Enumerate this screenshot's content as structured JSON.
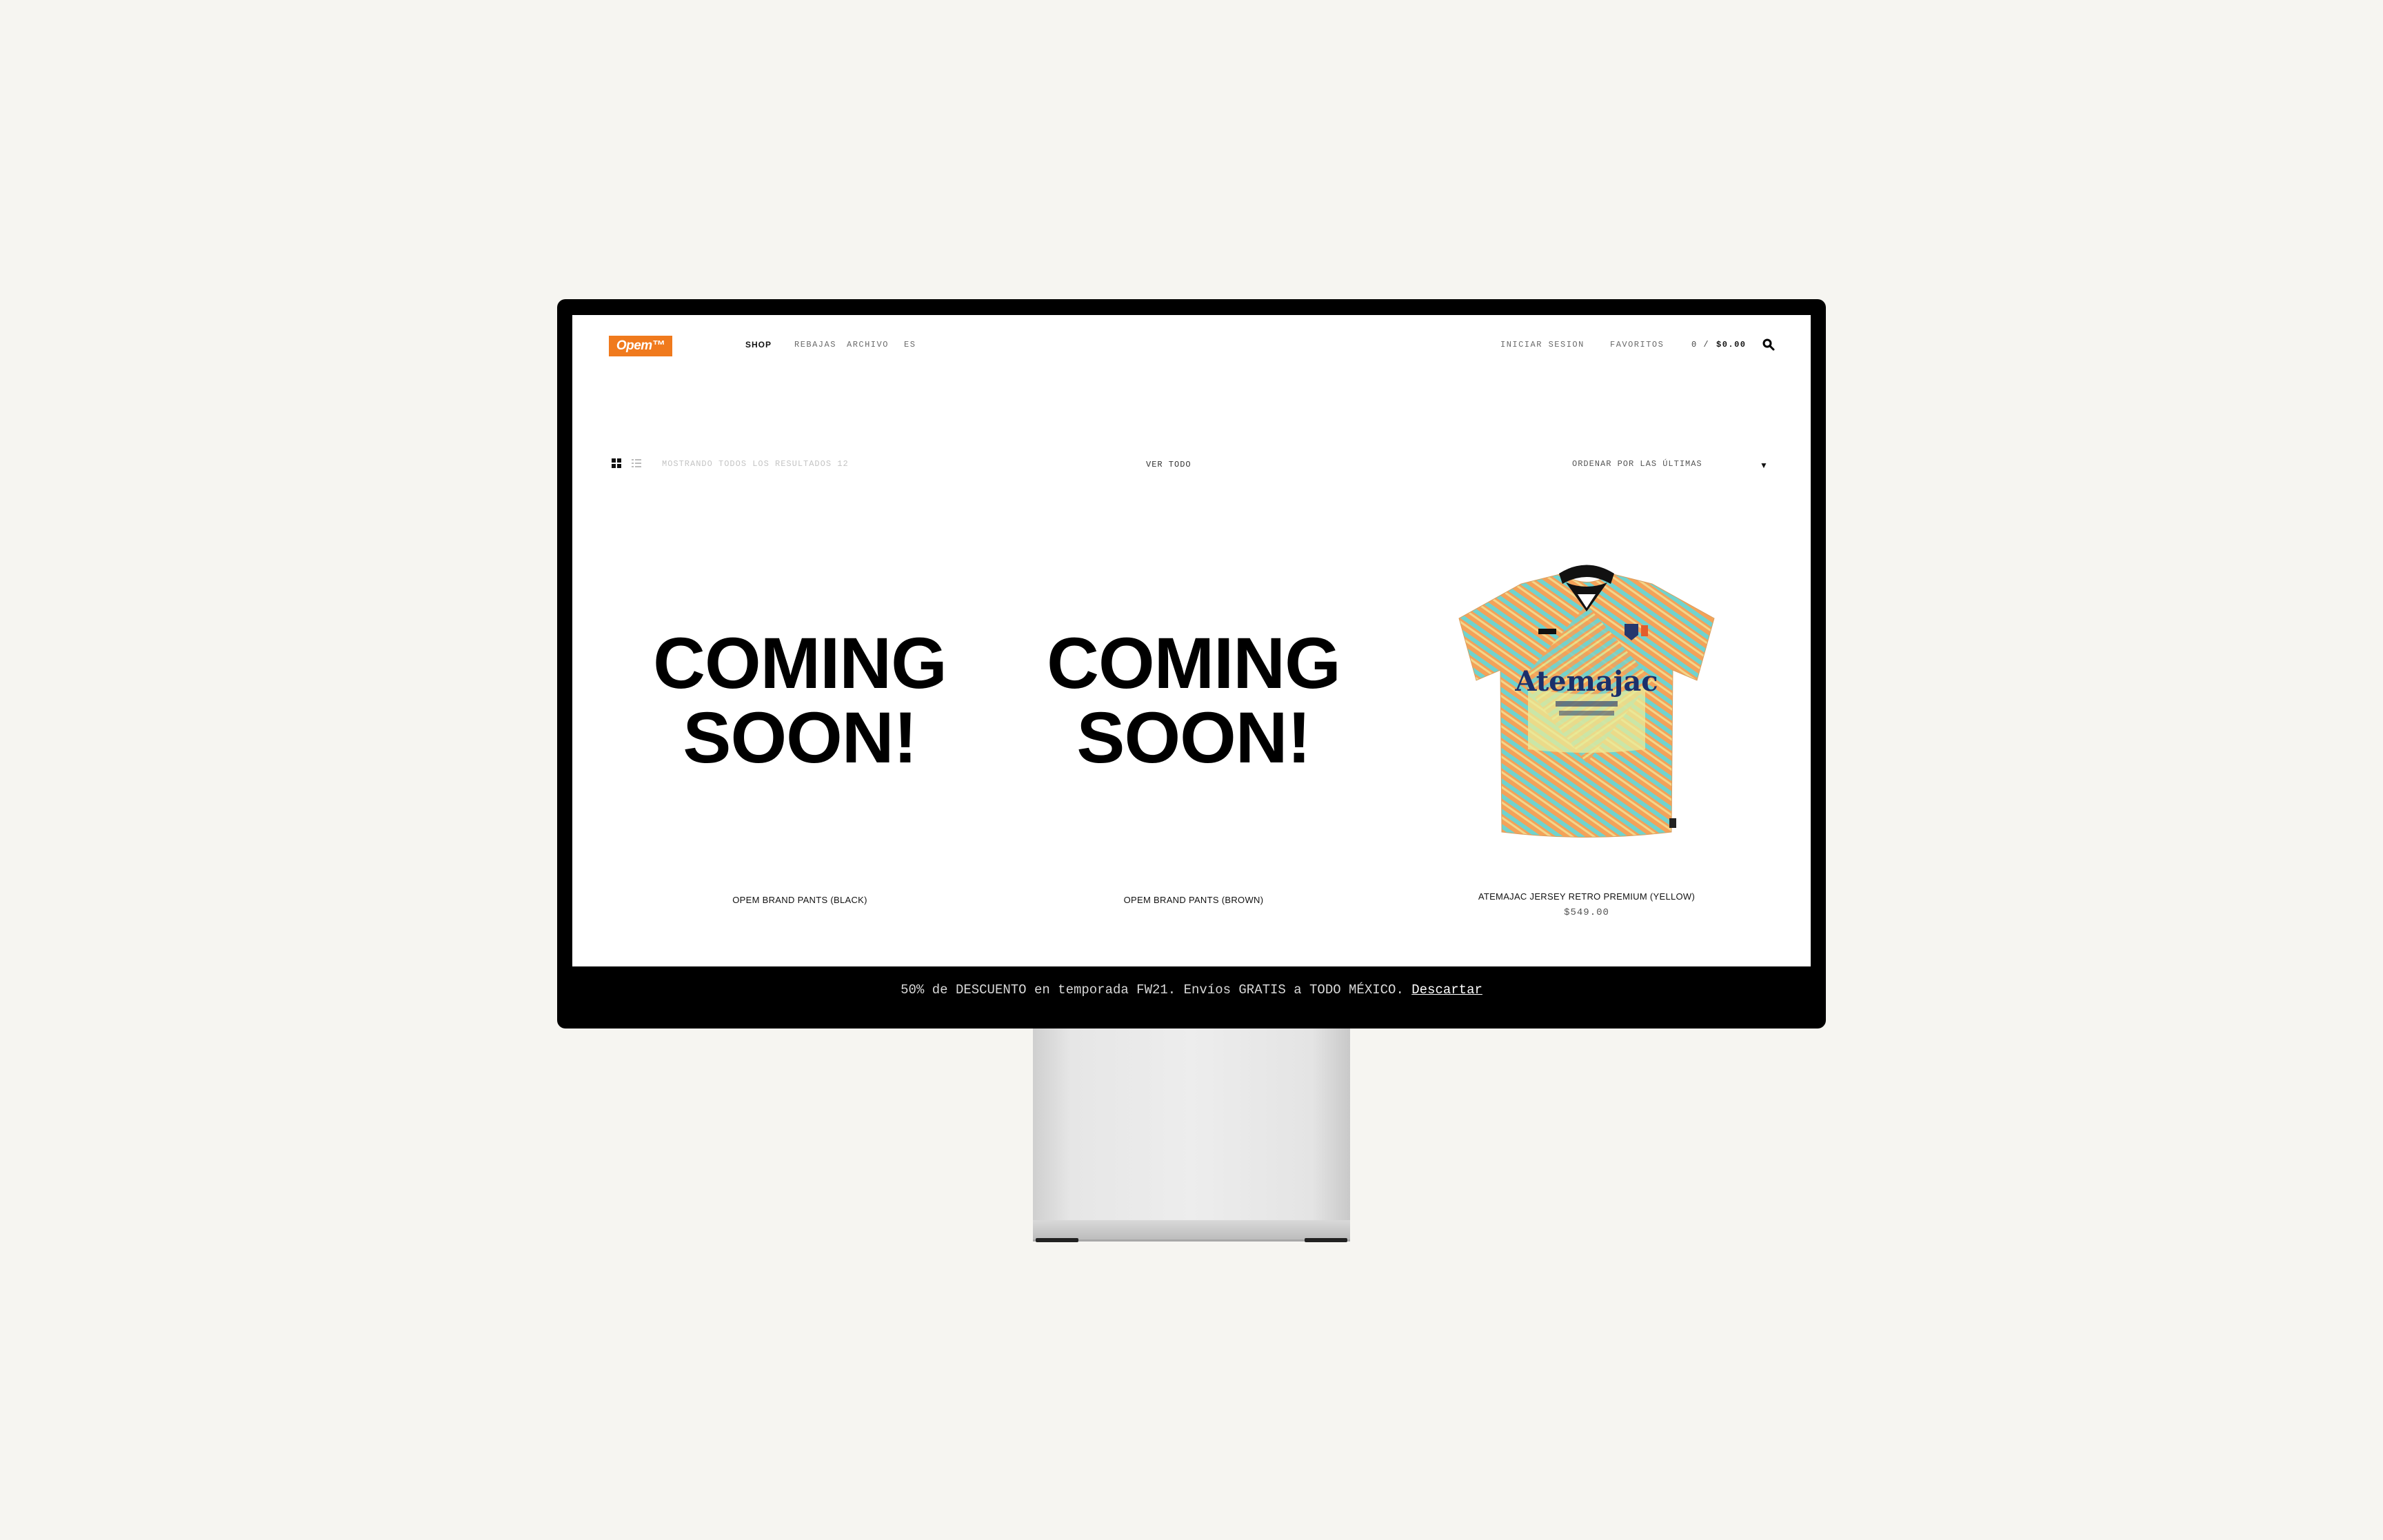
{
  "brand": {
    "logo_text": "Opem™",
    "accent": "#f07a1d"
  },
  "nav": {
    "items": [
      "SHOP",
      "REBAJAS",
      "ARCHIVO",
      "ES"
    ],
    "login": "INICIAR SESION",
    "favorites": "FAVORITOS",
    "cart_count": "0 /",
    "cart_total": "$0.00",
    "search_icon": "search-icon"
  },
  "toolbar": {
    "view_icons": [
      "grid-view-icon",
      "list-view-icon"
    ],
    "results_text": "MOSTRANDO TODOS LOS RESULTADOS 12",
    "filter_label": "VER TODO",
    "sort_label": "ORDENAR POR LAS ÚLTIMAS"
  },
  "products": [
    {
      "name": "OPEM BRAND PANTS (BLACK)",
      "placeholder": [
        "COMING",
        "SOON!"
      ],
      "price": ""
    },
    {
      "name": "OPEM BRAND PANTS (BROWN)",
      "placeholder": [
        "COMING",
        "SOON!"
      ],
      "price": ""
    },
    {
      "name": "ATEMAJAC JERSEY RETRO PREMIUM (YELLOW)",
      "jersey_text": "Atemajac",
      "price": "$549.00"
    }
  ],
  "banner": {
    "text": "50% de DESCUENTO en temporada FW21. Envíos GRATIS a TODO MÉXICO.",
    "dismiss": "Descartar"
  }
}
